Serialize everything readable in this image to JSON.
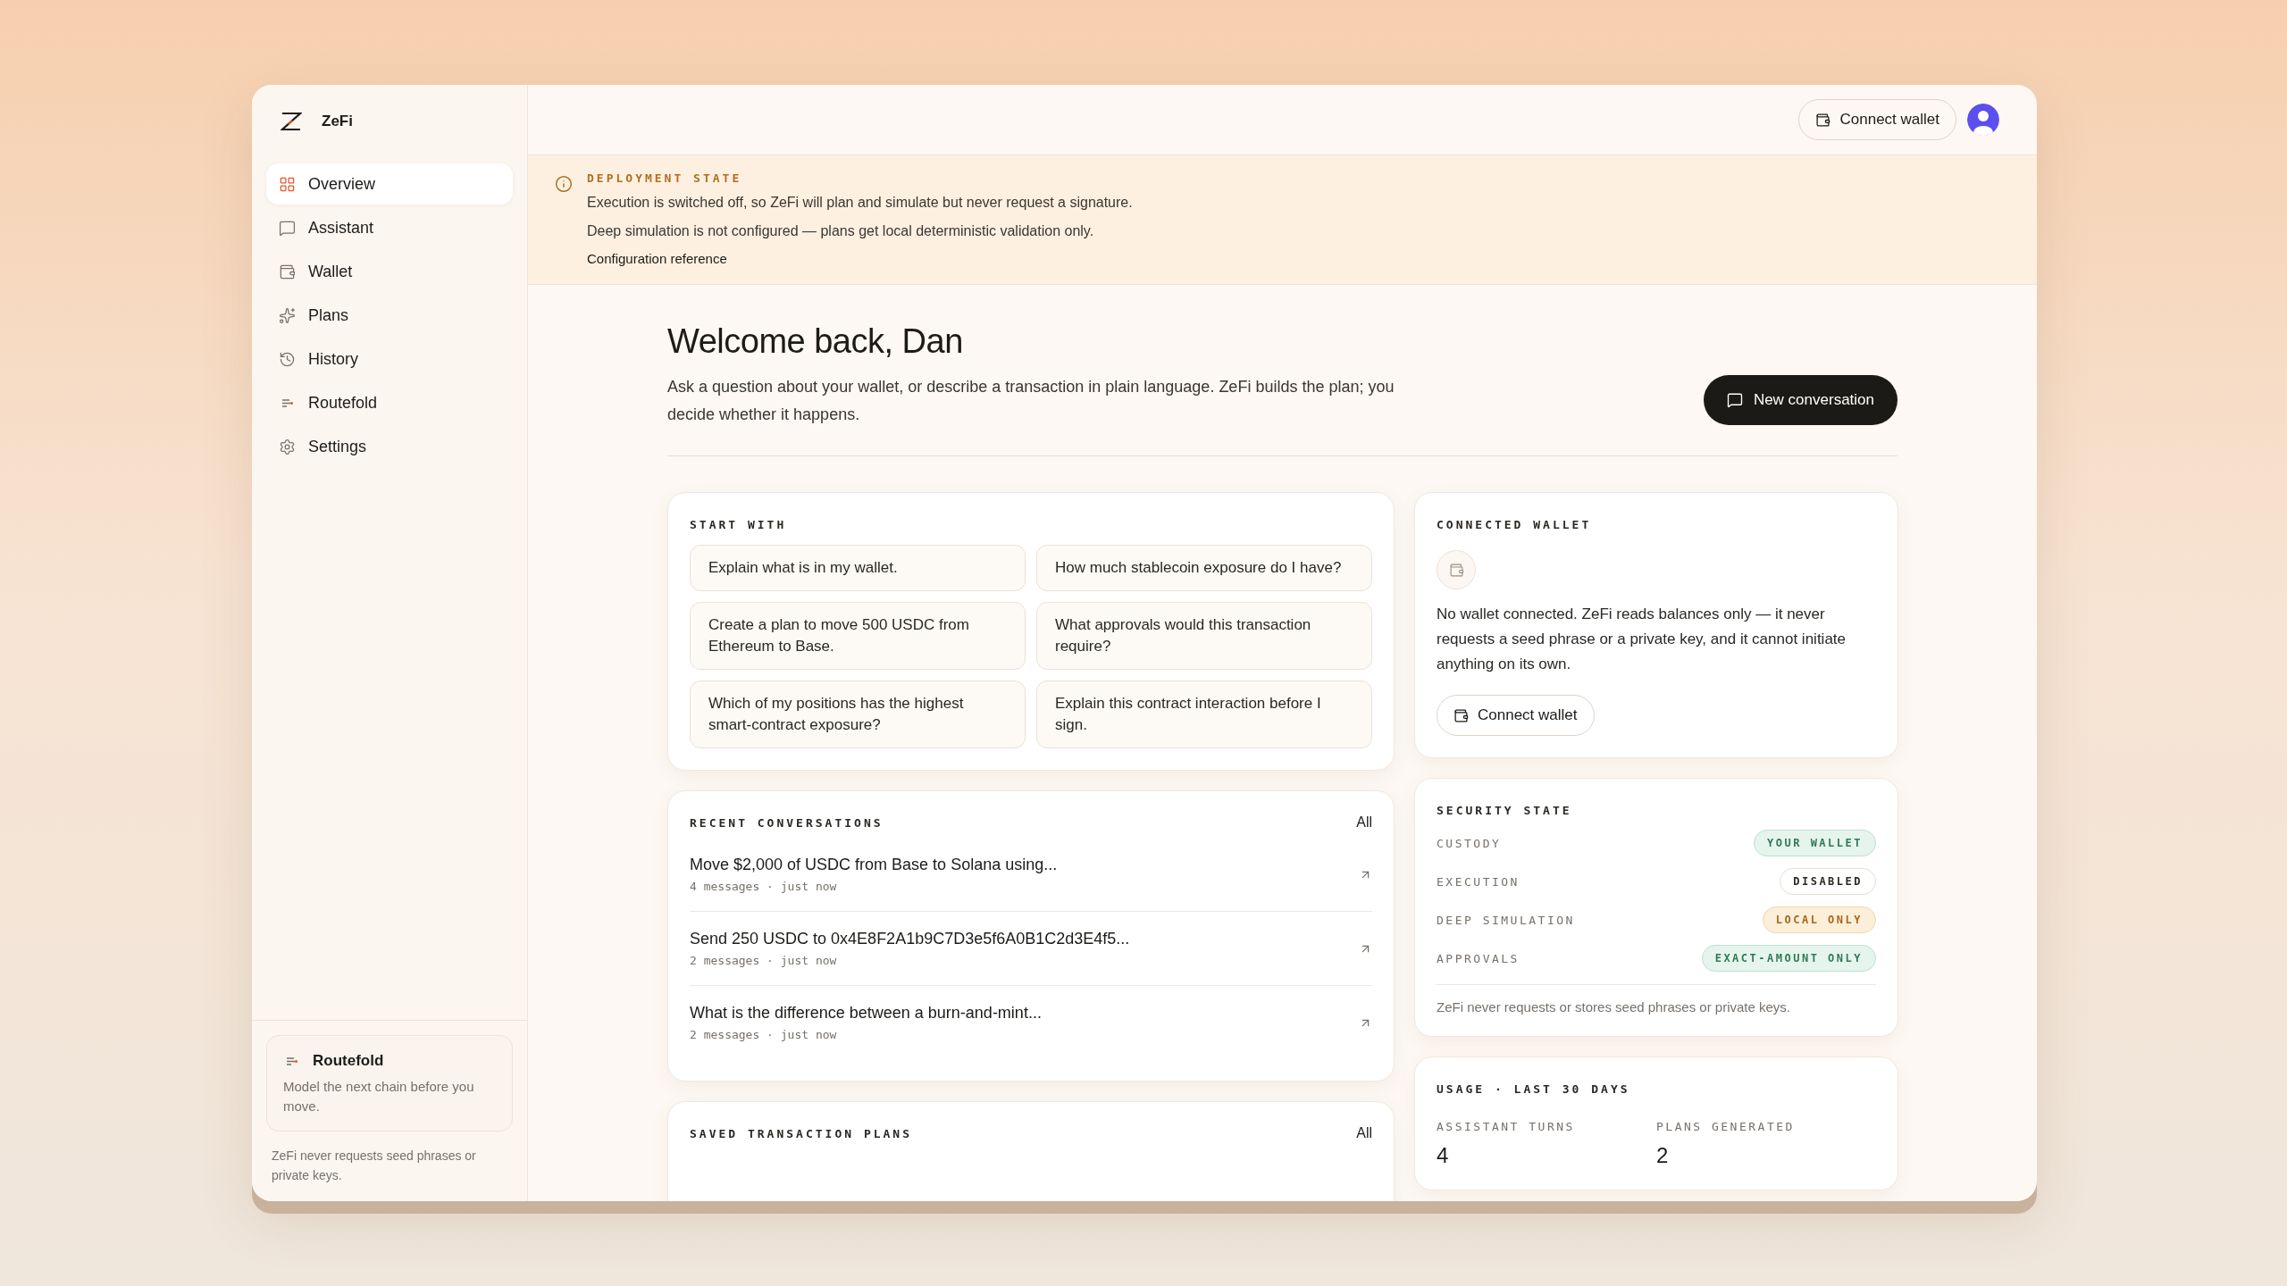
{
  "brand": {
    "name": "ZeFi"
  },
  "nav": [
    {
      "label": "Overview",
      "kind": "overview",
      "selected": true
    },
    {
      "label": "Assistant",
      "kind": "assistant",
      "selected": false
    },
    {
      "label": "Wallet",
      "kind": "wallet",
      "selected": false
    },
    {
      "label": "Plans",
      "kind": "plans",
      "selected": false
    },
    {
      "label": "History",
      "kind": "history",
      "selected": false
    },
    {
      "label": "Routefold",
      "kind": "routefold",
      "selected": false
    },
    {
      "label": "Settings",
      "kind": "settings",
      "selected": false
    }
  ],
  "promo": {
    "title": "Routefold",
    "text": "Model the next chain before you move."
  },
  "sidebar_note": "ZeFi never requests seed phrases or private keys.",
  "header": {
    "connect_button": "Connect wallet"
  },
  "banner": {
    "title": "DEPLOYMENT STATE",
    "lines": [
      "Execution is switched off, so ZeFi will plan and simulate but never request a signature.",
      "Deep simulation is not configured — plans get local deterministic validation only."
    ],
    "link": "Configuration reference"
  },
  "welcome": {
    "title": "Welcome back, Dan",
    "text": "Ask a question about your wallet, or describe a transaction in plain language. ZeFi builds the plan; you decide whether it happens.",
    "button": "New conversation"
  },
  "start_with": {
    "title": "START WITH",
    "prompts": [
      "Explain what is in my wallet.",
      "How much stablecoin exposure do I have?",
      "Create a plan to move 500 USDC from Ethereum to Base.",
      "What approvals would this transaction require?",
      "Which of my positions has the highest smart-contract exposure?",
      "Explain this contract interaction before I sign."
    ]
  },
  "recent": {
    "title": "RECENT CONVERSATIONS",
    "all": "All",
    "items": [
      {
        "title": "Move $2,000 of USDC from Base to Solana using...",
        "meta": "4 messages · just now"
      },
      {
        "title": "Send 250 USDC to 0x4E8F2A1b9C7D3e5f6A0B1C2d3E4f5...",
        "meta": "2 messages · just now"
      },
      {
        "title": "What is the difference between a burn-and-mint...",
        "meta": "2 messages · just now"
      }
    ]
  },
  "saved_plans": {
    "title": "SAVED TRANSACTION PLANS",
    "all": "All"
  },
  "wallet_card": {
    "title": "CONNECTED WALLET",
    "text": "No wallet connected. ZeFi reads balances only — it never requests a seed phrase or a private key, and it cannot initiate anything on its own.",
    "button": "Connect wallet"
  },
  "security": {
    "title": "SECURITY STATE",
    "rows": [
      {
        "label": "CUSTODY",
        "value": "YOUR WALLET",
        "kind": "positive"
      },
      {
        "label": "EXECUTION",
        "value": "DISABLED",
        "kind": "neutral"
      },
      {
        "label": "DEEP SIMULATION",
        "value": "LOCAL ONLY",
        "kind": "warning"
      },
      {
        "label": "APPROVALS",
        "value": "EXACT-AMOUNT ONLY",
        "kind": "positive"
      }
    ],
    "note": "ZeFi never requests or stores seed phrases or private keys."
  },
  "usage": {
    "title": "USAGE · LAST 30 DAYS",
    "stats": [
      {
        "label": "ASSISTANT TURNS",
        "value": "4"
      },
      {
        "label": "PLANS GENERATED",
        "value": "2"
      }
    ]
  }
}
